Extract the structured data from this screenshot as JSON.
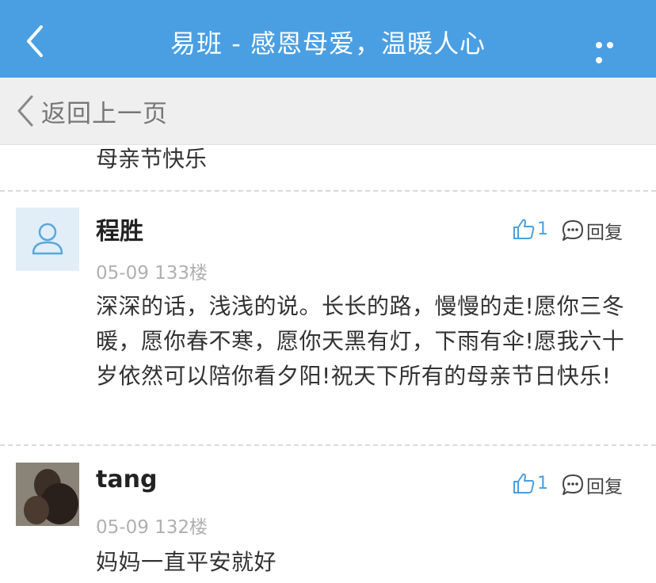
{
  "header": {
    "title": "易班 - 感恩母爱，温暖人心"
  },
  "subnav": {
    "back_label": "返回上一页"
  },
  "previous_comment_tail": "母亲节快乐",
  "comments": [
    {
      "user": "程胜",
      "meta": "05-09 133楼",
      "likes": "1",
      "reply_label": "回复",
      "text": "深深的话，浅浅的说。长长的路，慢慢的走!愿你三冬暖，愿你春不寒，愿你天黑有灯，下雨有伞!愿我六十岁依然可以陪你看夕阳!祝天下所有的母亲节日快乐!"
    },
    {
      "user": "tang",
      "meta": "05-09 132楼",
      "likes": "1",
      "reply_label": "回复",
      "text": "妈妈一直平安就好"
    }
  ],
  "colors": {
    "accent": "#4a9fe3",
    "subbar_bg": "#efefef",
    "meta_text": "#b0b0b0"
  }
}
